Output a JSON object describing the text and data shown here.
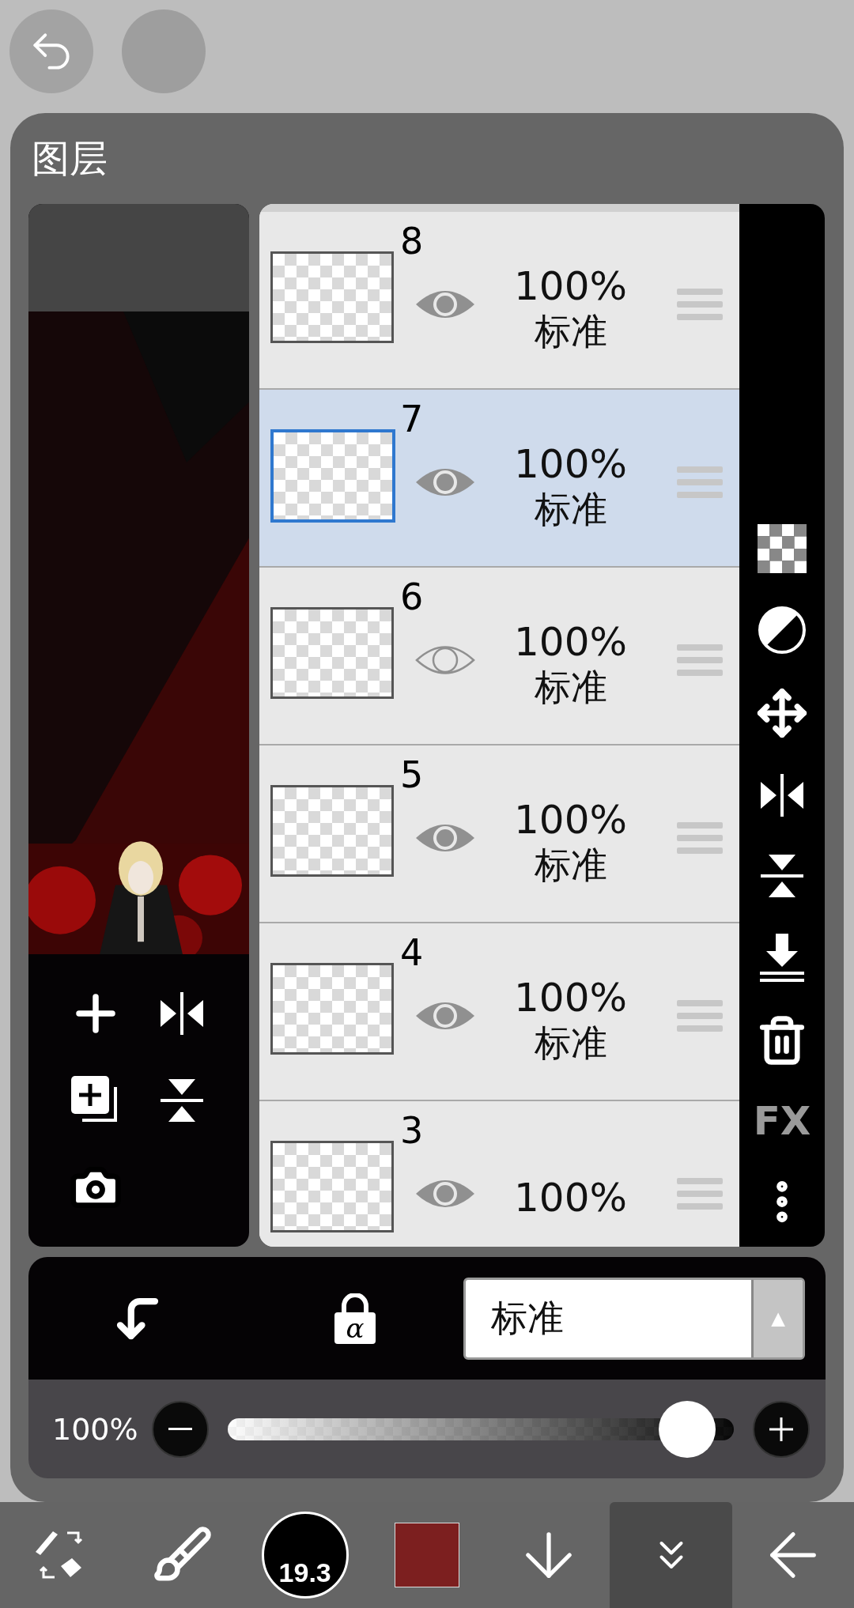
{
  "panel": {
    "title": "图层"
  },
  "layers": [
    {
      "number": "8",
      "opacity": "100%",
      "blend": "标准",
      "visible": true,
      "selected": false
    },
    {
      "number": "7",
      "opacity": "100%",
      "blend": "标准",
      "visible": true,
      "selected": true
    },
    {
      "number": "6",
      "opacity": "100%",
      "blend": "标准",
      "visible": false,
      "selected": false
    },
    {
      "number": "5",
      "opacity": "100%",
      "blend": "标准",
      "visible": true,
      "selected": false
    },
    {
      "number": "4",
      "opacity": "100%",
      "blend": "标准",
      "visible": true,
      "selected": false
    },
    {
      "number": "3",
      "opacity": "100%",
      "visible": true,
      "selected": false
    }
  ],
  "side_tools": {
    "fx": "FX"
  },
  "controls": {
    "alpha_symbol": "α",
    "blend_mode": "标准",
    "arrow": "▲"
  },
  "opacity": {
    "reading": "100%",
    "level": 0.96
  },
  "bottom_tools": [
    {
      "kind": "swap",
      "selected": false
    },
    {
      "kind": "brush",
      "selected": false
    },
    {
      "kind": "size",
      "label": "19.3",
      "selected": false
    },
    {
      "kind": "color",
      "selected": false
    },
    {
      "kind": "down",
      "selected": false
    },
    {
      "kind": "layers",
      "selected": true
    },
    {
      "kind": "back",
      "selected": false
    }
  ]
}
